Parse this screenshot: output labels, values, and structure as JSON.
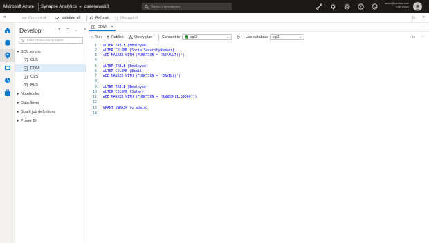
{
  "topbar": {
    "brand": "Microsoft Azure",
    "product": "Synapse Analytics",
    "workspace": "cseenews10",
    "search_placeholder": "Search resources",
    "user_line1": "azure@contoso.com",
    "user_line2": "CONTOSO"
  },
  "toolbar": {
    "commit": "Commit all",
    "validate": "Validate all",
    "refresh": "Refresh",
    "discard": "Discard all"
  },
  "rail": {
    "items": [
      "home-icon",
      "data-icon",
      "develop-icon",
      "integrate-icon",
      "monitor-icon",
      "manage-icon"
    ],
    "active_index": 2
  },
  "develop_panel": {
    "title": "Develop",
    "filter_placeholder": "Filter resources by name",
    "sql_scripts": "SQL scripts",
    "scripts": [
      "CLS",
      "DDM",
      "OLS",
      "RLS"
    ],
    "selected_script": "DDM",
    "folders": [
      "Notebooks",
      "Data flows",
      "Spark job definitions",
      "Power BI"
    ]
  },
  "editor": {
    "tab_name": "DDM",
    "run": "Run",
    "publish": "Publish",
    "query_plan": "Query plan",
    "connect_to_label": "Connect to",
    "connect_to_value": "sql1",
    "use_database_label": "Use database",
    "use_database_value": "sql1"
  },
  "code_lines": [
    "ALTER TABLE [Employee]",
    "ALTER COLUMN [SocialSecurityNumber]",
    "ADD MASKED WITH (FUNCTION = 'DEFAULT()')",
    "",
    "ALTER TABLE [Employee]",
    "ALTER COLUMN [Email]",
    "ADD MASKED WITH (FUNCTION = 'EMAIL()')",
    "",
    "ALTER TABLE [Employee]",
    "ALTER COLUMN [Salary]",
    "ADD MASKED WITH (FUNCTION = 'RANDOM(1,69000)')",
    "",
    "GRANT UNMASK to admin1",
    ""
  ],
  "colors": {
    "topbar_bg": "#1b1a19",
    "accent": "#0078d4",
    "keyword": "#0000ff",
    "string": "#a31515",
    "connected": "#107c10"
  }
}
